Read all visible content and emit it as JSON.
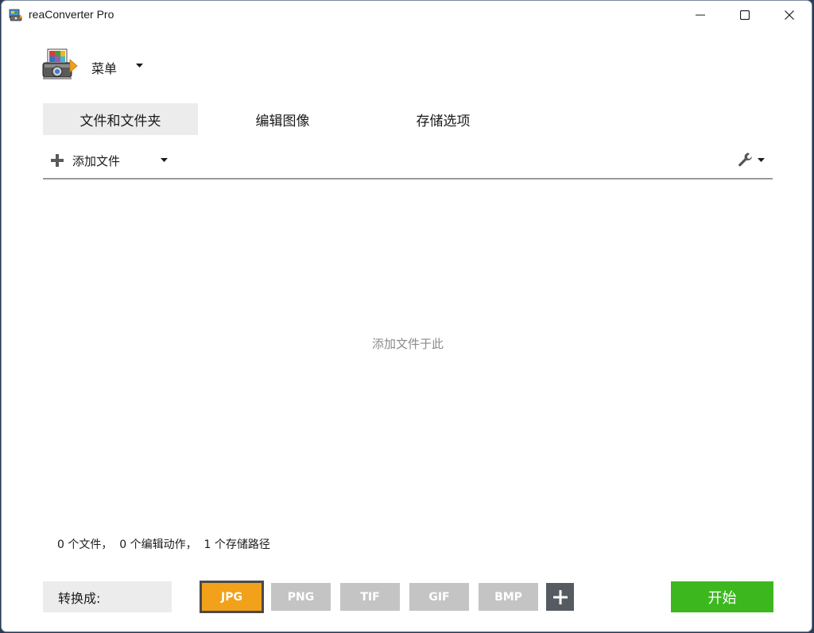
{
  "window": {
    "title": "reaConverter Pro",
    "icon": "reaconverter-app-icon"
  },
  "menu": {
    "label": "菜单",
    "logo": "reaconverter-logo"
  },
  "tabs": [
    {
      "label": "文件和文件夹",
      "active": true
    },
    {
      "label": "编辑图像",
      "active": false
    },
    {
      "label": "存储选项",
      "active": false
    }
  ],
  "toolbar": {
    "add_files_label": "添加文件"
  },
  "drop_area": {
    "hint": "添加文件于此"
  },
  "status": {
    "text": "0 个文件，  0 个编辑动作，  1 个存储路径"
  },
  "convert": {
    "label": "转换成:",
    "formats": [
      "JPG",
      "PNG",
      "TIF",
      "GIF",
      "BMP"
    ],
    "selected": "JPG"
  },
  "start_button": {
    "label": "开始"
  },
  "colors": {
    "accent_selected": "#f2a11a",
    "format_inactive": "#c4c4c4",
    "start_green": "#3cb81e",
    "tab_active_bg": "#ececec"
  }
}
